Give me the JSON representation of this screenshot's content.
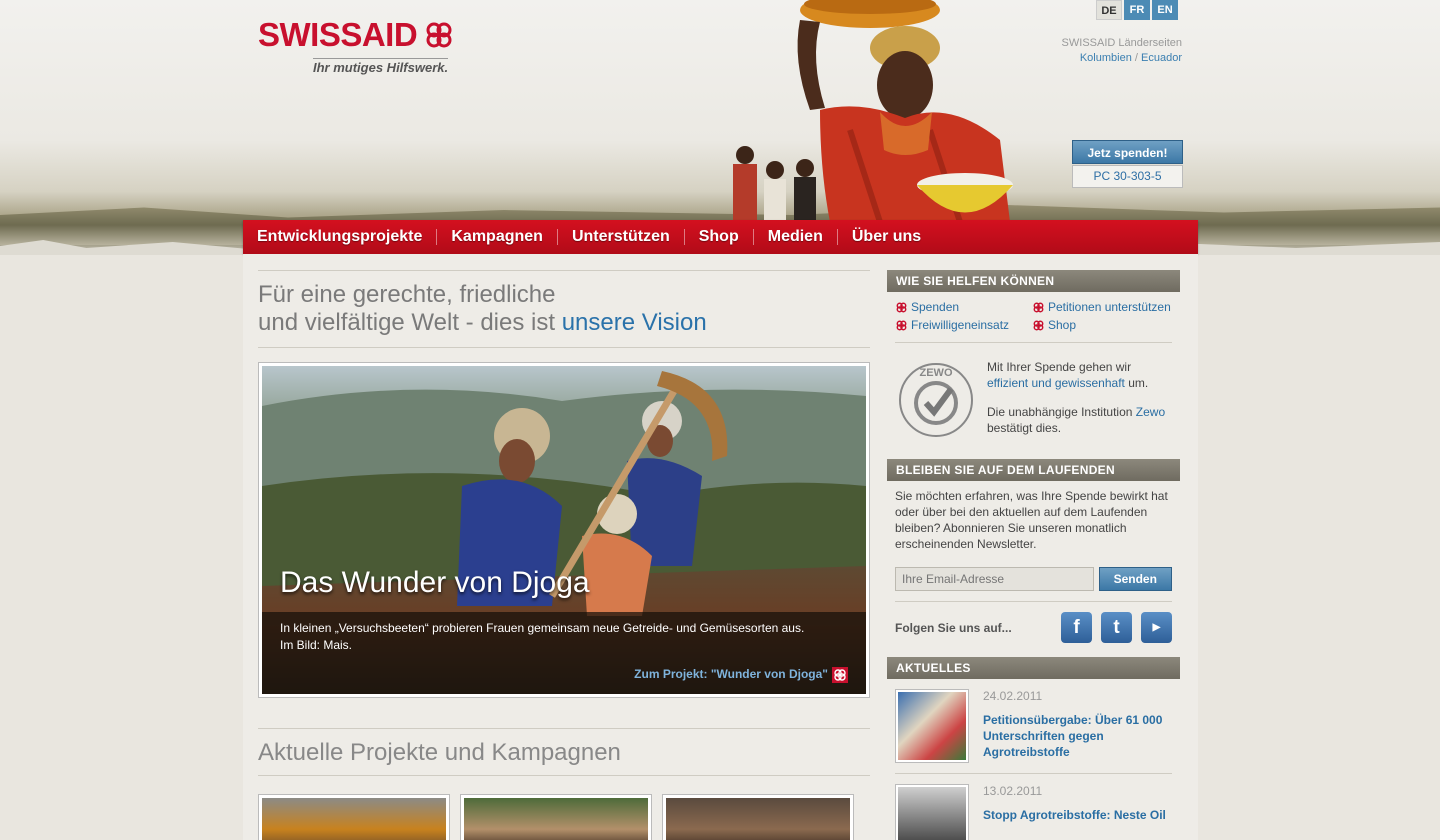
{
  "brand": {
    "name": "SWISSAID",
    "tagline": "Ihr mutiges Hilfswerk.",
    "color": "#c8102e"
  },
  "languages": [
    {
      "code": "DE",
      "active": true
    },
    {
      "code": "FR",
      "active": false
    },
    {
      "code": "EN",
      "active": false
    }
  ],
  "country_sites": {
    "label": "SWISSAID Länderseiten",
    "links": [
      "Kolumbien",
      "Ecuador"
    ],
    "separator": "/"
  },
  "donate": {
    "button": "Jetz spenden!",
    "account": "PC 30-303-5"
  },
  "nav": [
    "Entwicklungsprojekte",
    "Kampagnen",
    "Unterstützen",
    "Shop",
    "Medien",
    "Über uns"
  ],
  "vision": {
    "line1": "Für eine gerechte, friedliche",
    "line2": "und vielfältige Welt - dies ist",
    "link": "unsere Vision"
  },
  "feature": {
    "title": "Das Wunder von Djoga",
    "caption_line1": "In kleinen „Versuchsbeeten“ probieren Frauen gemeinsam neue Getreide- und Gemüsesorten aus.",
    "caption_line2": "Im Bild: Mais.",
    "link": "Zum Projekt: \"Wunder von Djoga\""
  },
  "projects": {
    "heading": "Aktuelle Projekte und Kampagnen"
  },
  "sidebar": {
    "help": {
      "heading": "WIE SIE HELFEN KÖNNEN",
      "links": [
        "Spenden",
        "Petitionen unterstützen",
        "Freiwilligeneinsatz",
        "Shop"
      ]
    },
    "zewo": {
      "text1_a": "Mit Ihrer Spende gehen wir",
      "text1_link": "effizient und gewissenhaft",
      "text1_b": "um.",
      "text2_a": "Die unabhängige Institution",
      "text2_link": "Zewo",
      "text2_b": "bestätigt dies.",
      "seal_label": "ZEWO"
    },
    "newsletter": {
      "heading": "BLEIBEN SIE AUF DEM LAUFENDEN",
      "text": "Sie möchten erfahren, was Ihre Spende bewirkt hat oder über bei den aktuellen auf dem Laufenden bleiben? Abonnieren Sie unseren monatlich erscheinenden Newsletter.",
      "placeholder": "Ihre Email-Adresse",
      "button": "Senden"
    },
    "follow": {
      "label": "Folgen Sie uns auf...",
      "networks": [
        "facebook-icon",
        "twitter-icon",
        "youtube-icon"
      ]
    },
    "news": {
      "heading": "AKTUELLES",
      "items": [
        {
          "date": "24.02.2011",
          "title": "Petitionsübergabe: Über 61 000 Unterschriften gegen Agrotreibstoffe"
        },
        {
          "date": "13.02.2011",
          "title": "Stopp Agrotreibstoffe: Neste Oil"
        }
      ]
    }
  }
}
